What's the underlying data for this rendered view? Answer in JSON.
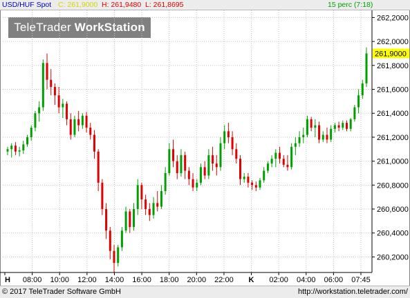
{
  "header": {
    "instrument": "USD/HUF Spot",
    "close": "C: 261,9000",
    "high": "H: 261,9480",
    "low": "L: 261,8695",
    "interval": "15 perc (7:18)"
  },
  "watermark": {
    "brand_regular": "TeleTrader",
    "brand_bold": "WorkStation"
  },
  "footer": {
    "copyright": "© 2017 TeleTrader Software GmbH",
    "url": "http://workstation.teletrader.com/"
  },
  "colors": {
    "up": "#00a000",
    "down": "#e00000",
    "grid": "#c0c0c0",
    "last_price_bg": "#ffff00"
  },
  "chart_data": {
    "type": "candlestick",
    "ylim": [
      260.07,
      262.26
    ],
    "y_ticks": [
      260.2,
      260.4,
      260.6,
      260.8,
      261.0,
      261.2,
      261.4,
      261.6,
      261.8,
      262.0,
      262.2
    ],
    "y_tick_labels": [
      "260,2000",
      "260,4000",
      "260,6000",
      "260,8000",
      "261,0000",
      "261,2000",
      "261,4000",
      "261,6000",
      "261,8000",
      "262,0000",
      "262,2000"
    ],
    "last_price_label": "261,9000",
    "last_price": 261.9,
    "x_labels": [
      "H",
      "08:00",
      "10:00",
      "12:00",
      "14:00",
      "16:00",
      "18:00",
      "20:00",
      "22:00",
      "K",
      "02:00",
      "04:00",
      "06:00",
      "07:45"
    ],
    "candles": [
      {
        "o": 261.08,
        "h": 261.12,
        "l": 261.05,
        "c": 261.1
      },
      {
        "o": 261.1,
        "h": 261.15,
        "l": 261.03,
        "c": 261.13
      },
      {
        "o": 261.13,
        "h": 261.16,
        "l": 261.05,
        "c": 261.08
      },
      {
        "o": 261.08,
        "h": 261.12,
        "l": 261.04,
        "c": 261.09
      },
      {
        "o": 261.09,
        "h": 261.17,
        "l": 261.06,
        "c": 261.14
      },
      {
        "o": 261.14,
        "h": 261.22,
        "l": 261.12,
        "c": 261.2
      },
      {
        "o": 261.2,
        "h": 261.3,
        "l": 261.17,
        "c": 261.28
      },
      {
        "o": 261.28,
        "h": 261.42,
        "l": 261.25,
        "c": 261.4
      },
      {
        "o": 261.4,
        "h": 261.5,
        "l": 261.33,
        "c": 261.45
      },
      {
        "o": 261.45,
        "h": 261.85,
        "l": 261.42,
        "c": 261.82
      },
      {
        "o": 261.82,
        "h": 261.9,
        "l": 261.6,
        "c": 261.68
      },
      {
        "o": 261.68,
        "h": 261.77,
        "l": 261.55,
        "c": 261.62
      },
      {
        "o": 261.62,
        "h": 261.65,
        "l": 261.47,
        "c": 261.55
      },
      {
        "o": 261.55,
        "h": 261.62,
        "l": 261.4,
        "c": 261.45
      },
      {
        "o": 261.45,
        "h": 261.52,
        "l": 261.36,
        "c": 261.48
      },
      {
        "o": 261.48,
        "h": 261.5,
        "l": 261.3,
        "c": 261.35
      },
      {
        "o": 261.35,
        "h": 261.4,
        "l": 261.18,
        "c": 261.22
      },
      {
        "o": 261.22,
        "h": 261.38,
        "l": 261.2,
        "c": 261.35
      },
      {
        "o": 261.35,
        "h": 261.42,
        "l": 261.25,
        "c": 261.3
      },
      {
        "o": 261.3,
        "h": 261.4,
        "l": 261.27,
        "c": 261.38
      },
      {
        "o": 261.38,
        "h": 261.41,
        "l": 261.24,
        "c": 261.28
      },
      {
        "o": 261.28,
        "h": 261.32,
        "l": 261.18,
        "c": 261.22
      },
      {
        "o": 261.22,
        "h": 261.26,
        "l": 261.02,
        "c": 261.08
      },
      {
        "o": 261.08,
        "h": 261.1,
        "l": 260.75,
        "c": 260.82
      },
      {
        "o": 260.82,
        "h": 260.85,
        "l": 260.55,
        "c": 260.6
      },
      {
        "o": 260.6,
        "h": 260.65,
        "l": 260.35,
        "c": 260.42
      },
      {
        "o": 260.42,
        "h": 260.45,
        "l": 260.18,
        "c": 260.25
      },
      {
        "o": 260.25,
        "h": 260.3,
        "l": 260.07,
        "c": 260.15
      },
      {
        "o": 260.15,
        "h": 260.3,
        "l": 260.12,
        "c": 260.28
      },
      {
        "o": 260.28,
        "h": 260.45,
        "l": 260.25,
        "c": 260.42
      },
      {
        "o": 260.42,
        "h": 260.62,
        "l": 260.4,
        "c": 260.58
      },
      {
        "o": 260.58,
        "h": 260.6,
        "l": 260.4,
        "c": 260.45
      },
      {
        "o": 260.45,
        "h": 260.65,
        "l": 260.42,
        "c": 260.6
      },
      {
        "o": 260.6,
        "h": 260.85,
        "l": 260.55,
        "c": 260.8
      },
      {
        "o": 260.8,
        "h": 260.82,
        "l": 260.6,
        "c": 260.68
      },
      {
        "o": 260.68,
        "h": 260.72,
        "l": 260.55,
        "c": 260.6
      },
      {
        "o": 260.6,
        "h": 260.65,
        "l": 260.5,
        "c": 260.55
      },
      {
        "o": 260.55,
        "h": 260.7,
        "l": 260.52,
        "c": 260.65
      },
      {
        "o": 260.65,
        "h": 260.75,
        "l": 260.58,
        "c": 260.62
      },
      {
        "o": 260.62,
        "h": 260.8,
        "l": 260.6,
        "c": 260.75
      },
      {
        "o": 260.75,
        "h": 260.95,
        "l": 260.72,
        "c": 260.9
      },
      {
        "o": 260.9,
        "h": 261.15,
        "l": 260.88,
        "c": 261.1
      },
      {
        "o": 261.1,
        "h": 261.18,
        "l": 260.95,
        "c": 261.0
      },
      {
        "o": 261.0,
        "h": 261.05,
        "l": 260.85,
        "c": 260.9
      },
      {
        "o": 260.9,
        "h": 261.1,
        "l": 260.87,
        "c": 261.05
      },
      {
        "o": 261.05,
        "h": 261.08,
        "l": 260.85,
        "c": 260.92
      },
      {
        "o": 260.92,
        "h": 260.95,
        "l": 260.8,
        "c": 260.85
      },
      {
        "o": 260.85,
        "h": 260.9,
        "l": 260.75,
        "c": 260.78
      },
      {
        "o": 260.78,
        "h": 260.85,
        "l": 260.75,
        "c": 260.82
      },
      {
        "o": 260.82,
        "h": 260.98,
        "l": 260.8,
        "c": 260.95
      },
      {
        "o": 260.95,
        "h": 261.0,
        "l": 260.85,
        "c": 260.88
      },
      {
        "o": 260.88,
        "h": 261.1,
        "l": 260.85,
        "c": 261.05
      },
      {
        "o": 261.05,
        "h": 261.12,
        "l": 260.92,
        "c": 260.98
      },
      {
        "o": 260.98,
        "h": 261.05,
        "l": 260.88,
        "c": 260.95
      },
      {
        "o": 260.95,
        "h": 261.2,
        "l": 260.92,
        "c": 261.15
      },
      {
        "o": 261.15,
        "h": 261.3,
        "l": 261.1,
        "c": 261.25
      },
      {
        "o": 261.25,
        "h": 261.32,
        "l": 261.15,
        "c": 261.2
      },
      {
        "o": 261.2,
        "h": 261.25,
        "l": 261.05,
        "c": 261.1
      },
      {
        "o": 261.1,
        "h": 261.15,
        "l": 260.98,
        "c": 261.02
      },
      {
        "o": 261.02,
        "h": 261.05,
        "l": 260.8,
        "c": 260.85
      },
      {
        "o": 260.85,
        "h": 260.9,
        "l": 260.82,
        "c": 260.87
      },
      {
        "o": 260.87,
        "h": 260.9,
        "l": 260.78,
        "c": 260.82
      },
      {
        "o": 260.82,
        "h": 260.84,
        "l": 260.76,
        "c": 260.8
      },
      {
        "o": 260.8,
        "h": 260.83,
        "l": 260.75,
        "c": 260.78
      },
      {
        "o": 260.78,
        "h": 260.86,
        "l": 260.76,
        "c": 260.84
      },
      {
        "o": 260.84,
        "h": 260.95,
        "l": 260.82,
        "c": 260.92
      },
      {
        "o": 260.92,
        "h": 261.0,
        "l": 260.9,
        "c": 260.98
      },
      {
        "o": 260.98,
        "h": 261.05,
        "l": 260.95,
        "c": 261.02
      },
      {
        "o": 261.02,
        "h": 261.1,
        "l": 260.95,
        "c": 261.07
      },
      {
        "o": 261.07,
        "h": 261.12,
        "l": 260.98,
        "c": 261.02
      },
      {
        "o": 261.02,
        "h": 261.05,
        "l": 260.95,
        "c": 260.97
      },
      {
        "o": 260.97,
        "h": 261.05,
        "l": 260.92,
        "c": 260.95
      },
      {
        "o": 260.95,
        "h": 261.15,
        "l": 260.93,
        "c": 261.12
      },
      {
        "o": 261.12,
        "h": 261.2,
        "l": 261.05,
        "c": 261.15
      },
      {
        "o": 261.15,
        "h": 261.25,
        "l": 261.12,
        "c": 261.2
      },
      {
        "o": 261.2,
        "h": 261.28,
        "l": 261.15,
        "c": 261.22
      },
      {
        "o": 261.22,
        "h": 261.38,
        "l": 261.2,
        "c": 261.35
      },
      {
        "o": 261.35,
        "h": 261.37,
        "l": 261.25,
        "c": 261.28
      },
      {
        "o": 261.28,
        "h": 261.35,
        "l": 261.2,
        "c": 261.3
      },
      {
        "o": 261.3,
        "h": 261.33,
        "l": 261.15,
        "c": 261.18
      },
      {
        "o": 261.18,
        "h": 261.25,
        "l": 261.16,
        "c": 261.22
      },
      {
        "o": 261.22,
        "h": 261.28,
        "l": 261.15,
        "c": 261.18
      },
      {
        "o": 261.18,
        "h": 261.3,
        "l": 261.16,
        "c": 261.27
      },
      {
        "o": 261.27,
        "h": 261.32,
        "l": 261.24,
        "c": 261.3
      },
      {
        "o": 261.3,
        "h": 261.33,
        "l": 261.25,
        "c": 261.28
      },
      {
        "o": 261.28,
        "h": 261.34,
        "l": 261.26,
        "c": 261.32
      },
      {
        "o": 261.32,
        "h": 261.34,
        "l": 261.25,
        "c": 261.27
      },
      {
        "o": 261.27,
        "h": 261.36,
        "l": 261.25,
        "c": 261.35
      },
      {
        "o": 261.35,
        "h": 261.47,
        "l": 261.33,
        "c": 261.45
      },
      {
        "o": 261.45,
        "h": 261.6,
        "l": 261.4,
        "c": 261.55
      },
      {
        "o": 261.55,
        "h": 261.68,
        "l": 261.52,
        "c": 261.65
      },
      {
        "o": 261.65,
        "h": 261.95,
        "l": 261.62,
        "c": 261.9
      }
    ]
  }
}
